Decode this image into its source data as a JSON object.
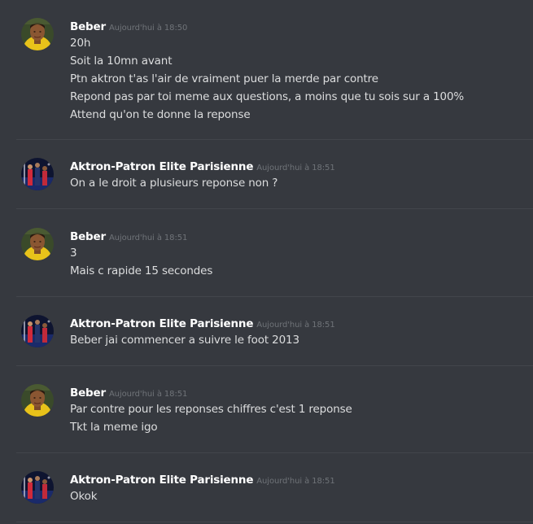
{
  "colors": {
    "background": "#36393f",
    "username": "#ffffff",
    "timestamp": "#6f7378",
    "message_text": "#dcddde",
    "divider": "#42454b"
  },
  "messages": [
    {
      "avatar": "beber-avatar",
      "author": "Beber",
      "timestamp": "Aujourd'hui à 18:50",
      "lines": [
        "20h",
        "Soit la 10mn avant",
        "Ptn aktron t'as l'air de vraiment puer la merde par contre",
        "Repond pas par toi meme aux questions, a moins que tu sois sur a 100%",
        "Attend qu'on te donne la reponse"
      ]
    },
    {
      "avatar": "aktron-avatar",
      "author": "Aktron-Patron Elite Parisienne",
      "timestamp": "Aujourd'hui à 18:51",
      "lines": [
        "On a le droit a plusieurs reponse non ?"
      ]
    },
    {
      "avatar": "beber-avatar",
      "author": "Beber",
      "timestamp": "Aujourd'hui à 18:51",
      "lines": [
        "3",
        "Mais c rapide 15 secondes"
      ]
    },
    {
      "avatar": "aktron-avatar",
      "author": "Aktron-Patron Elite Parisienne",
      "timestamp": "Aujourd'hui à 18:51",
      "lines": [
        "Beber jai commencer a suivre le foot 2013"
      ]
    },
    {
      "avatar": "beber-avatar",
      "author": "Beber",
      "timestamp": "Aujourd'hui à 18:51",
      "lines": [
        "Par contre pour les reponses chiffres c'est 1 reponse",
        "Tkt la meme igo"
      ]
    },
    {
      "avatar": "aktron-avatar",
      "author": "Aktron-Patron Elite Parisienne",
      "timestamp": "Aujourd'hui à 18:51",
      "lines": [
        "Okok"
      ]
    }
  ]
}
